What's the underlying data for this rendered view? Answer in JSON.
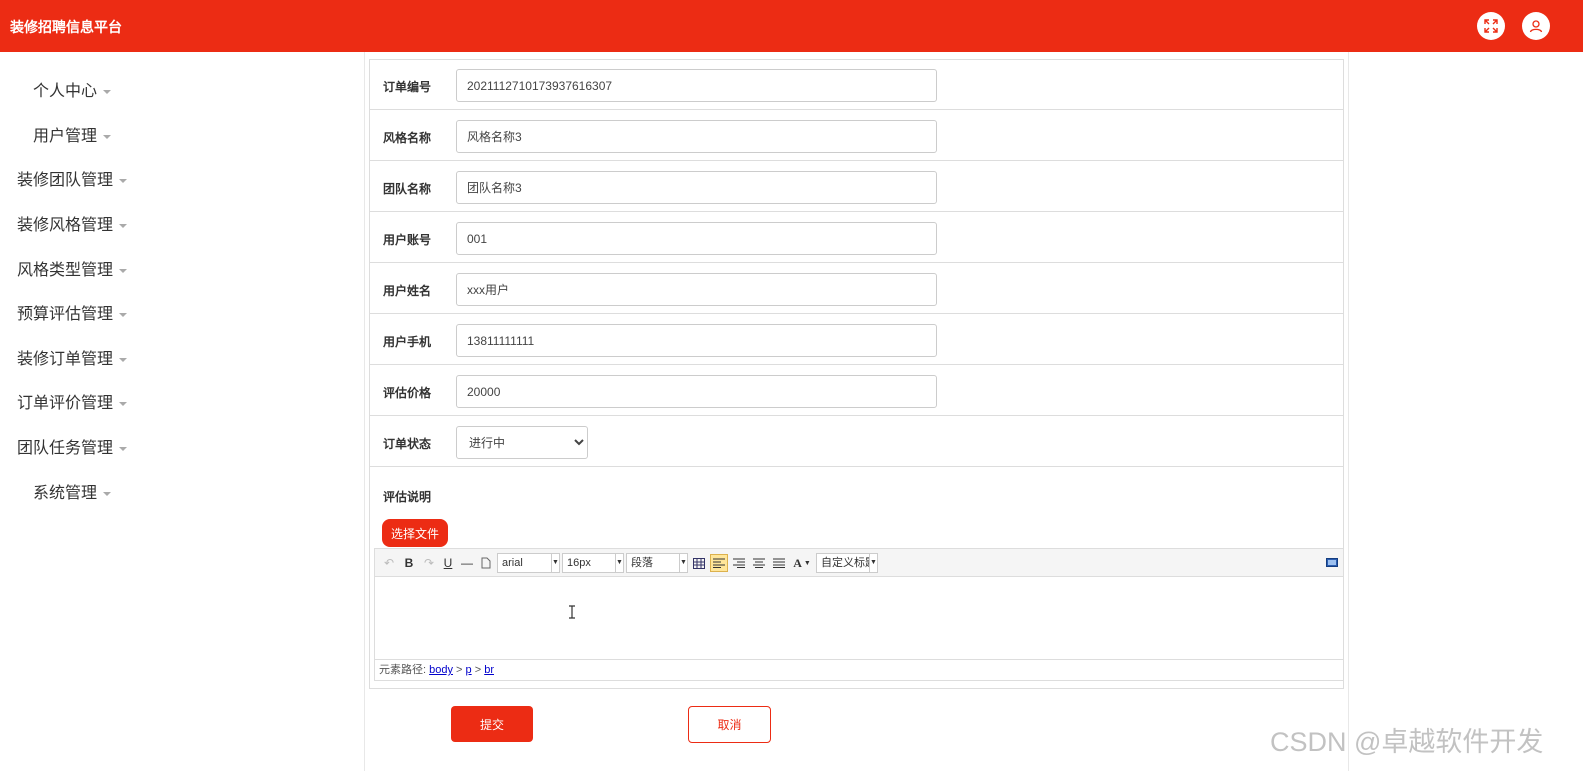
{
  "header": {
    "title": "装修招聘信息平台",
    "icons": [
      "fullscreen-icon",
      "user-icon"
    ]
  },
  "sidebar": {
    "items": [
      {
        "label": "个人中心"
      },
      {
        "label": "用户管理"
      },
      {
        "label": "装修团队管理"
      },
      {
        "label": "装修风格管理"
      },
      {
        "label": "风格类型管理"
      },
      {
        "label": "预算评估管理"
      },
      {
        "label": "装修订单管理"
      },
      {
        "label": "订单评价管理"
      },
      {
        "label": "团队任务管理"
      },
      {
        "label": "系统管理"
      }
    ]
  },
  "form": {
    "order_no": {
      "label": "订单编号",
      "value": "2021112710173937616307"
    },
    "style_name": {
      "label": "风格名称",
      "value": "风格名称3"
    },
    "team_name": {
      "label": "团队名称",
      "value": "团队名称3"
    },
    "user_account": {
      "label": "用户账号",
      "value": "001"
    },
    "user_name": {
      "label": "用户姓名",
      "value": "xxx用户"
    },
    "user_phone": {
      "label": "用户手机",
      "value": "13811111111"
    },
    "eval_price": {
      "label": "评估价格",
      "value": "20000"
    },
    "order_status": {
      "label": "订单状态",
      "value": "进行中"
    },
    "eval_desc": {
      "label": "评估说明"
    },
    "file_button": "选择文件"
  },
  "editor": {
    "font": "arial",
    "size": "16px",
    "paragraph": "段落",
    "custom_title": "自定义标题",
    "path_label": "元素路径:",
    "path": [
      "body",
      "p",
      "br"
    ]
  },
  "actions": {
    "submit": "提交",
    "cancel": "取消"
  },
  "watermark": "CSDN @卓越软件开发",
  "colors": {
    "brand": "#ec2c14"
  }
}
